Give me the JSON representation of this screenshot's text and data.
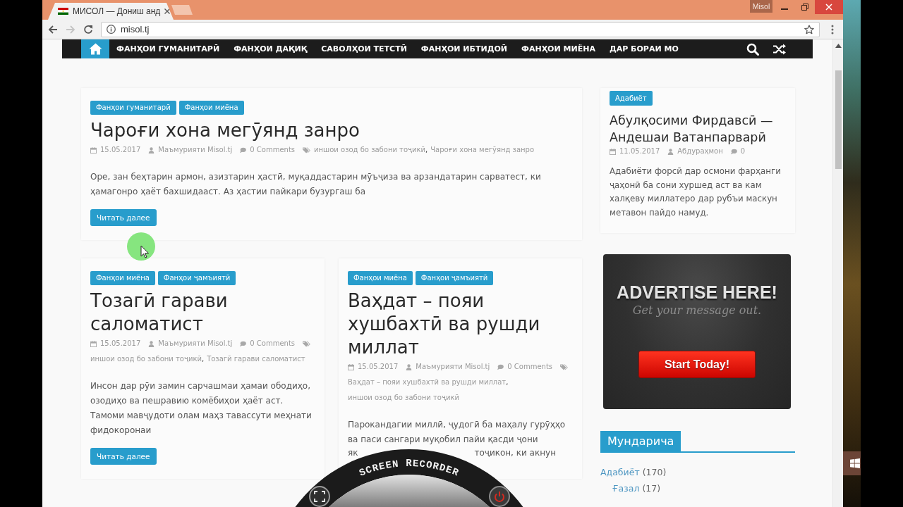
{
  "browser": {
    "tab": {
      "title": "МИСОЛ — Дониш анд"
    },
    "profile": "Misol",
    "nav_buttons": [
      {
        "kind": "back",
        "disabled": false
      },
      {
        "kind": "forward",
        "disabled": true
      },
      {
        "kind": "reload",
        "disabled": false
      }
    ],
    "address": "misol.tj"
  },
  "site_nav": {
    "items": [
      {
        "kind": "home",
        "selected": true
      },
      {
        "kind": "link",
        "label": "ФАНҲОИ ГУМАНИТАРӢ",
        "selected": false
      },
      {
        "kind": "link",
        "label": "ФАНҲОИ ДАҚИҚ",
        "selected": false
      },
      {
        "kind": "link",
        "label": "САВОЛҲОИ ТЕТСТӢ",
        "selected": false
      },
      {
        "kind": "link",
        "label": "ФАНҲОИ ИБТИДОӢ",
        "selected": false
      },
      {
        "kind": "link",
        "label": "ФАНҲОИ МИЁНА",
        "selected": false
      },
      {
        "kind": "link",
        "label": "ДАР БОРАИ МО",
        "selected": false
      }
    ]
  },
  "featured_post": {
    "categories": [
      "Фанҳои гуманитарӣ",
      "Фанҳои миёна"
    ],
    "title": "Чароғи хона мегӯянд занро",
    "meta": {
      "date": "15.05.2017",
      "author": "Маъмурияти Misol.tj",
      "comments": "0 Comments",
      "tags": [
        "иншои озод бо забони тоҷикӣ",
        "Чароғи хона мегӯянд занро"
      ],
      "tag_separator": ","
    },
    "excerpt": "Оре, зан беҳтарин армон, азизтарин ҳастӣ, муқаддастарин мӯъҷиза ва арзандатарин сарватест, ки ҳамагонро ҳаёт бахшидааст. Аз ҳастии пайкари бузургаш ба",
    "button": "Читать далее"
  },
  "posts": [
    {
      "categories": [
        "Фанҳои миёна",
        "Фанҳои ҷамъиятӣ"
      ],
      "title": "Тозагӣ гарави саломатист",
      "meta": {
        "date": "15.05.2017",
        "author": "Маъмурияти Misol.tj",
        "comments": "0 Comments",
        "tags": [
          "иншои озод бо забони тоҷикӣ",
          "Тозагӣ гарави саломатист"
        ],
        "tag_separator": ","
      },
      "excerpt": "Инсон дар рӯи замин сарчашмаи ҳамаи ободиҳо, озодиҳо ва пешравию комёбиҳои ҳаёт аст. Тамоми мавҷудоти олам маҳз тавассути меҳнати фидокоронаи",
      "button": "Читать далее"
    },
    {
      "categories": [
        "Фанҳои миёна",
        "Фанҳои ҷамъиятӣ"
      ],
      "title": "Ваҳдат – пояи хушбахтӣ ва рушди миллат",
      "meta": {
        "date": "15.05.2017",
        "author": "Маъмурияти Misol.tj",
        "comments": "0 Comments",
        "tags": [
          "Ваҳдат – пояи хушбахтӣ ва рушди миллат",
          "иншои озод бо забони тоҷикӣ"
        ],
        "tag_separator": ","
      },
      "excerpt": "Парокандагии миллӣ, ҷудогӣ ба маҳалу гурӯҳҳо ва паси сангари муқобил пайи қасди ҷони",
      "excerpt_visible_fragments": [
        "як",
        "тоҷикон, ки акнун"
      ]
    }
  ],
  "sidebar": {
    "post": {
      "category": "Адабиёт",
      "title": "Абулқосими Фирдавсӣ — Андешаи Ватанпарварӣ",
      "meta": {
        "date": "11.05.2017",
        "author": "Абдураҳмон",
        "comments": "0"
      },
      "excerpt": "Адабиёти форсӣ дар осмони фарҳанги ҷаҳонӣ ба сони хуршед аст ва кам халқеву миллатеро дар рубъи маскун метавон пайдо намуд."
    },
    "ad": {
      "headline": "ADVERTISE HERE!",
      "subline": "Get your message out.",
      "button": "Start Today!"
    },
    "widget": {
      "title": "Мундарича",
      "categories": [
        {
          "label": "Адабиёт",
          "count": "(170)",
          "children": [
            {
              "label": "Ғазал",
              "count": "(17)"
            }
          ]
        }
      ]
    }
  },
  "recorder": {
    "label": "SCREEN RECORDER"
  }
}
